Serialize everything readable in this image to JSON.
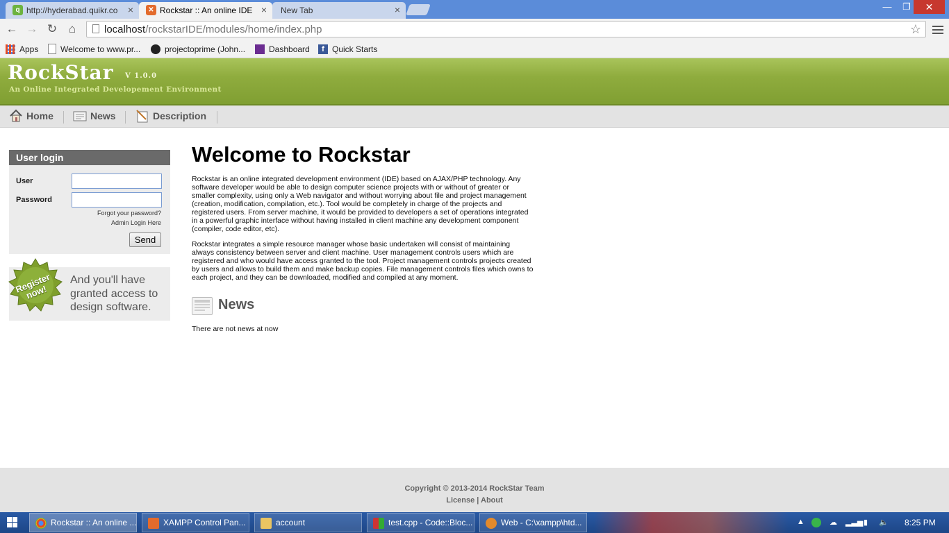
{
  "browser": {
    "tabs": [
      {
        "title": "http://hyderabad.quikr.co",
        "active": false
      },
      {
        "title": "Rockstar :: An online IDE",
        "active": true
      },
      {
        "title": "New Tab",
        "active": false
      }
    ],
    "url_host": "localhost",
    "url_path": "/rockstarIDE/modules/home/index.php",
    "bookmarks": [
      "Apps",
      "Welcome to www.pr...",
      "projectoprime (John...",
      "Dashboard",
      "Quick Starts"
    ]
  },
  "site": {
    "logo": "RockStar",
    "version": "V 1.0.0",
    "tagline": "An Online Integrated Developement Environment",
    "nav": [
      "Home",
      "News",
      "Description"
    ]
  },
  "login": {
    "title": "User login",
    "user_label": "User",
    "password_label": "Password",
    "user_value": "",
    "password_value": "",
    "forgot": "Forgot your password?",
    "admin": "Admin Login Here",
    "send": "Send"
  },
  "register": {
    "badge": "Register now!",
    "text": "And you'll have granted access to design software."
  },
  "main": {
    "title": "Welcome to Rockstar",
    "para1": "Rockstar is an online integrated development environment (IDE) based on AJAX/PHP technology. Any software developer would be able to design computer science projects with or without of greater or smaller complexity, using only a Web navigator and without worrying about file and project management (creation, modification, compilation, etc.). Tool would be completely in charge of the projects and registered users. From server machine, it would be provided to developers a set of operations integrated in a powerful graphic interface without having installed in client machine any development component (compiler, code editor, etc).",
    "para2": "Rockstar integrates a simple resource manager whose basic undertaken will consist of maintaining always consistency between server and client machine. User management controls users which are registered and who would have access granted to the tool. Project management controls projects created by users and allows to build them and make backup copies. File management controls files which owns to each project, and they can be downloaded, modified and compiled at any moment.",
    "news_heading": "News",
    "news_empty": "There are not news at now"
  },
  "footer": {
    "copyright": "Copyright © 2013-2014 RockStar Team",
    "license": "License",
    "separator": "|",
    "about": "About"
  },
  "taskbar": {
    "items": [
      "Rockstar :: An online ...",
      "XAMPP Control Pan...",
      "account",
      "test.cpp - Code::Bloc...",
      "Web - C:\\xampp\\htd..."
    ],
    "clock": "8:25 PM"
  }
}
